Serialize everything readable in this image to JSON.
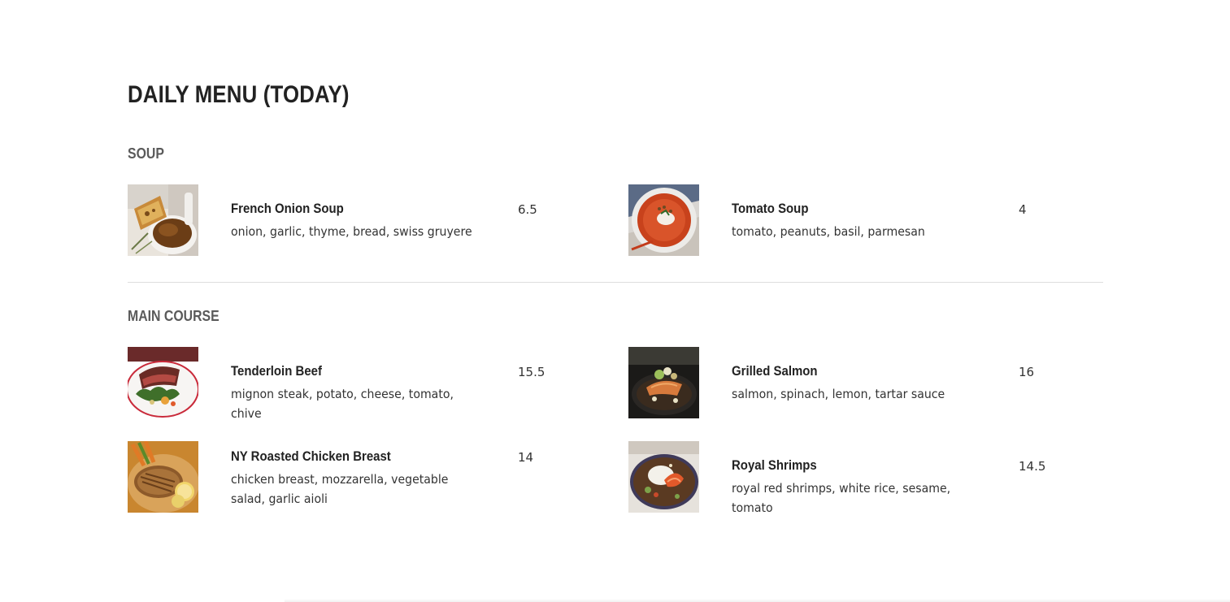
{
  "menu": {
    "title": "DAILY MENU (TODAY)"
  },
  "sections": [
    {
      "title": "SOUP",
      "items": [
        {
          "name": "French Onion Soup",
          "description": "onion, garlic, thyme, bread, swiss gruyere",
          "price": "6.5",
          "image_icon": "french-onion-soup-photo"
        },
        {
          "name": "Tomato Soup",
          "description": "tomato, peanuts, basil, parmesan",
          "price": "4",
          "image_icon": "tomato-soup-photo"
        }
      ]
    },
    {
      "title": "MAIN COURSE",
      "items": [
        {
          "name": "Tenderloin Beef",
          "description": "mignon steak, potato, cheese, tomato, chive",
          "price": "15.5",
          "image_icon": "tenderloin-beef-photo"
        },
        {
          "name": "Grilled Salmon",
          "description": "salmon, spinach, lemon, tartar sauce",
          "price": "16",
          "image_icon": "grilled-salmon-photo"
        },
        {
          "name": "NY Roasted Chicken Breast",
          "description": "chicken breast, mozzarella, vegetable salad, garlic aioli",
          "price": "14",
          "image_icon": "roasted-chicken-photo"
        },
        {
          "name": "Royal Shrimps",
          "description": "royal red shrimps, white rice, sesame, tomato",
          "price": "14.5",
          "image_icon": "royal-shrimps-photo"
        }
      ]
    }
  ]
}
